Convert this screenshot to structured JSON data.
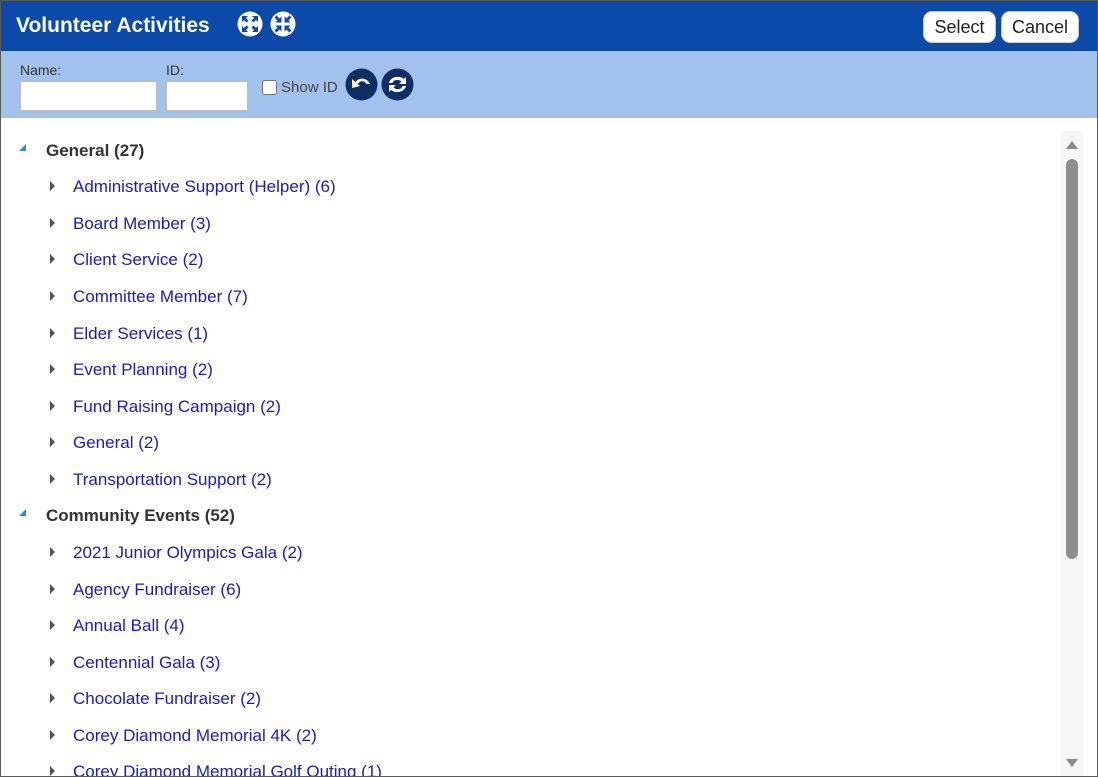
{
  "window": {
    "title": "Volunteer Activities",
    "select_label": "Select",
    "cancel_label": "Cancel",
    "accent_color": "#0b4aa8",
    "filter_bar_color": "#a2c1ec",
    "icons": [
      "expand-all-icon",
      "collapse-all-icon",
      "undo-icon",
      "refresh-icon"
    ]
  },
  "filter": {
    "name_label": "Name:",
    "name_value": "",
    "id_label": "ID:",
    "id_value": "",
    "show_id_label": "Show ID",
    "show_id_checked": false
  },
  "groups": [
    {
      "label": "General (27)",
      "expanded": true,
      "items": [
        "Administrative Support (Helper) (6)",
        "Board Member (3)",
        "Client Service (2)",
        "Committee Member (7)",
        "Elder Services (1)",
        "Event Planning (2)",
        "Fund Raising Campaign (2)",
        "General (2)",
        "Transportation Support (2)"
      ]
    },
    {
      "label": "Community Events (52)",
      "expanded": true,
      "items": [
        "2021 Junior Olympics Gala (2)",
        "Agency Fundraiser (6)",
        "Annual Ball (4)",
        "Centennial Gala (3)",
        "Chocolate Fundraiser (2)",
        "Corey Diamond Memorial 4K (2)",
        "Corey Diamond Memorial Golf Outing (1)"
      ]
    }
  ]
}
